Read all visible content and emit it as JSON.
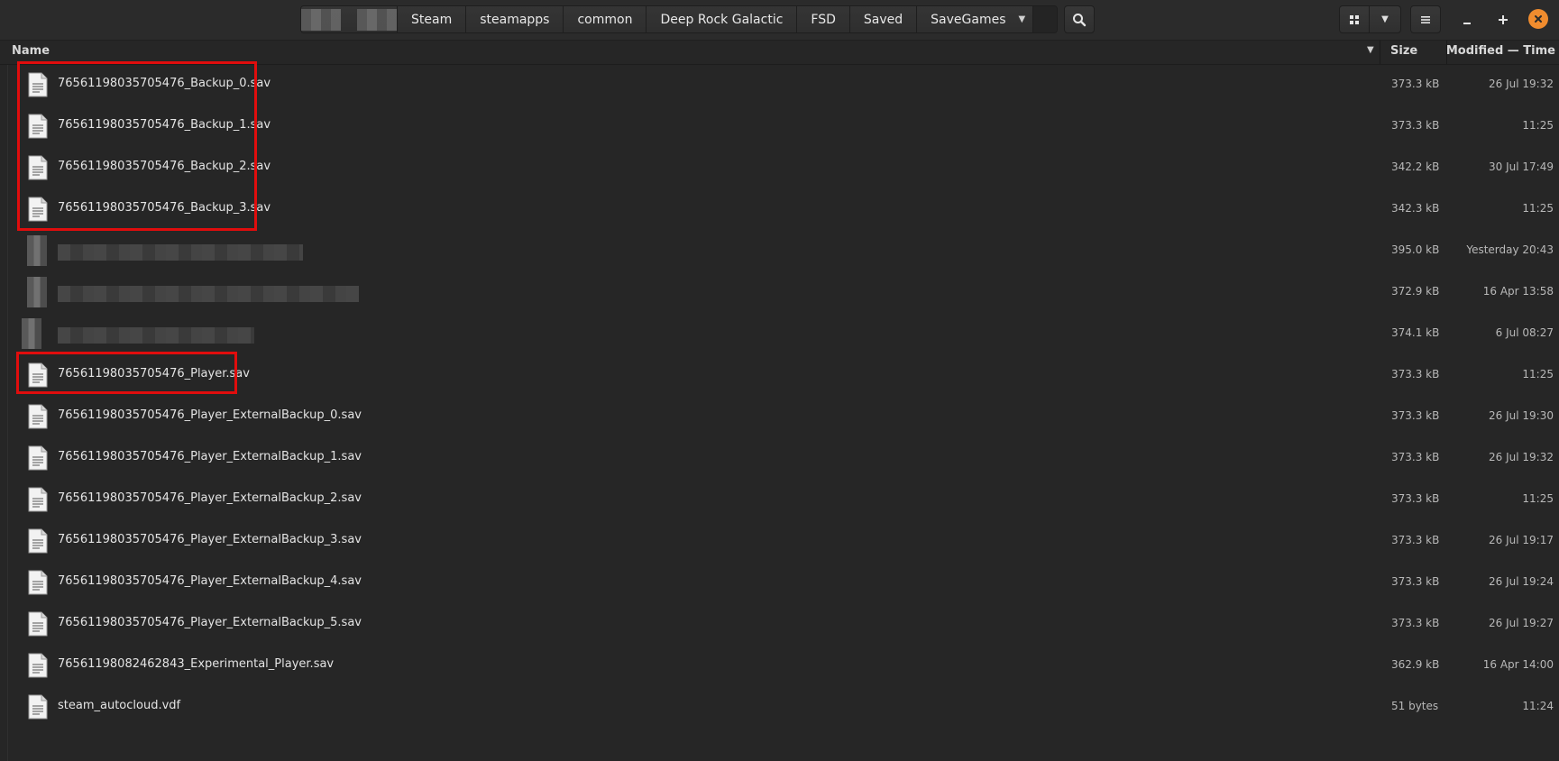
{
  "pathbar": {
    "crumbs": [
      "Steam",
      "steamapps",
      "common",
      "Deep Rock Galactic",
      "FSD",
      "Saved",
      "SaveGames"
    ]
  },
  "columns": {
    "name": "Name",
    "size": "Size",
    "modified": "Modified — Time"
  },
  "icons": {
    "search": "search-icon",
    "grid": "grid-view-icon",
    "view_dropdown": "chevron-down-icon",
    "menu": "hamburger-menu-icon",
    "minimize": "minimize-icon",
    "maximize": "maximize-icon",
    "close": "close-icon",
    "file": "text-file-icon"
  },
  "files": [
    {
      "name": "76561198035705476_Backup_0.sav",
      "size": "373.3 kB",
      "modified": "26 Jul 19:32"
    },
    {
      "name": "76561198035705476_Backup_1.sav",
      "size": "373.3 kB",
      "modified": "11:25"
    },
    {
      "name": "76561198035705476_Backup_2.sav",
      "size": "342.2 kB",
      "modified": "30 Jul 17:49"
    },
    {
      "name": "76561198035705476_Backup_3.sav",
      "size": "342.3 kB",
      "modified": "11:25"
    },
    {
      "name": "",
      "size": "395.0 kB",
      "modified": "Yesterday 20:43",
      "redacted": true
    },
    {
      "name": "",
      "size": "372.9 kB",
      "modified": "16 Apr 13:58",
      "redacted": true
    },
    {
      "name": "",
      "size": "374.1 kB",
      "modified": "6 Jul 08:27",
      "redacted": true
    },
    {
      "name": "76561198035705476_Player.sav",
      "size": "373.3 kB",
      "modified": "11:25"
    },
    {
      "name": "76561198035705476_Player_ExternalBackup_0.sav",
      "size": "373.3 kB",
      "modified": "26 Jul 19:30"
    },
    {
      "name": "76561198035705476_Player_ExternalBackup_1.sav",
      "size": "373.3 kB",
      "modified": "26 Jul 19:32"
    },
    {
      "name": "76561198035705476_Player_ExternalBackup_2.sav",
      "size": "373.3 kB",
      "modified": "11:25"
    },
    {
      "name": "76561198035705476_Player_ExternalBackup_3.sav",
      "size": "373.3 kB",
      "modified": "26 Jul 19:17"
    },
    {
      "name": "76561198035705476_Player_ExternalBackup_4.sav",
      "size": "373.3 kB",
      "modified": "26 Jul 19:24"
    },
    {
      "name": "76561198035705476_Player_ExternalBackup_5.sav",
      "size": "373.3 kB",
      "modified": "26 Jul 19:27"
    },
    {
      "name": "76561198082462843_Experimental_Player.sav",
      "size": "362.9 kB",
      "modified": "16 Apr 14:00"
    },
    {
      "name": "steam_autocloud.vdf",
      "size": "51 bytes",
      "modified": "11:24"
    }
  ],
  "colors": {
    "highlight": "#e00d0d",
    "close_button": "#f08c2e"
  }
}
